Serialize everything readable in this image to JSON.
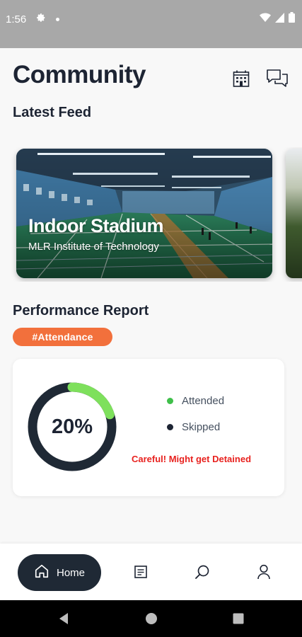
{
  "status_bar": {
    "time": "1:56"
  },
  "header": {
    "title": "Community"
  },
  "feed": {
    "section_title": "Latest Feed",
    "cards": [
      {
        "title": "Indoor Stadium",
        "subtitle": "MLR Institute of Technology"
      }
    ]
  },
  "report": {
    "section_title": "Performance Report",
    "tag": "#Attendance",
    "percent_label": "20%",
    "attended_fraction": 0.2,
    "legend": [
      {
        "label": "Attended",
        "color": "#3fbf4a"
      },
      {
        "label": "Skipped",
        "color": "#1d2433"
      }
    ],
    "warning": "Careful! Might get Detained"
  },
  "bottom_nav": {
    "home_label": "Home"
  },
  "colors": {
    "accent": "#f2703c",
    "progress": "#7ee05c",
    "track": "#1f2935",
    "warning": "#e8221f"
  }
}
